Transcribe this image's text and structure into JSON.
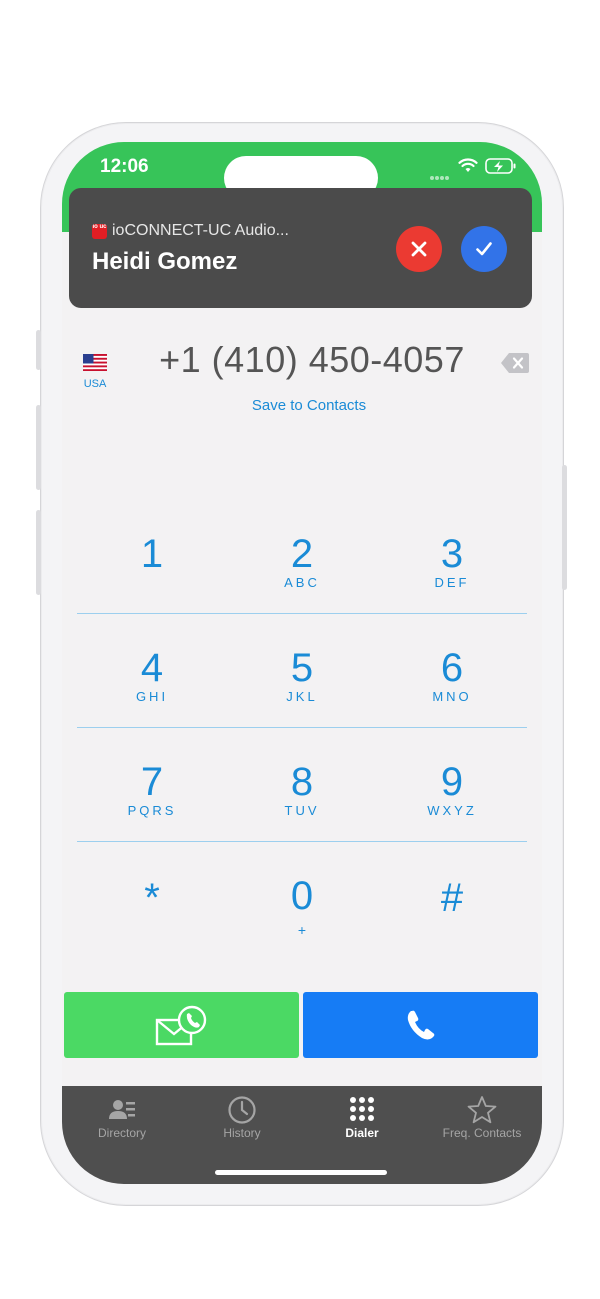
{
  "status_bar": {
    "time": "12:06"
  },
  "incoming_call": {
    "app_icon_text": "io uc",
    "app_name": "ioCONNECT-UC Audio...",
    "caller_name": "Heidi Gomez",
    "decline_icon": "close-icon",
    "accept_icon": "checkmark-icon"
  },
  "dialer": {
    "country_code": "USA",
    "phone_number": "+1 (410) 450-4057",
    "save_link": "Save to Contacts",
    "keys": [
      {
        "digit": "1",
        "letters": ""
      },
      {
        "digit": "2",
        "letters": "ABC"
      },
      {
        "digit": "3",
        "letters": "DEF"
      },
      {
        "digit": "4",
        "letters": "GHI"
      },
      {
        "digit": "5",
        "letters": "JKL"
      },
      {
        "digit": "6",
        "letters": "MNO"
      },
      {
        "digit": "7",
        "letters": "PQRS"
      },
      {
        "digit": "8",
        "letters": "TUV"
      },
      {
        "digit": "9",
        "letters": "WXYZ"
      },
      {
        "digit": "*",
        "letters": ""
      },
      {
        "digit": "0",
        "letters": "+"
      },
      {
        "digit": "#",
        "letters": ""
      }
    ]
  },
  "actions": {
    "voicemail_icon": "voicemail-icon",
    "call_icon": "phone-icon"
  },
  "tabs": [
    {
      "label": "Directory",
      "icon": "directory-icon",
      "active": false
    },
    {
      "label": "History",
      "icon": "clock-icon",
      "active": false
    },
    {
      "label": "Dialer",
      "icon": "keypad-icon",
      "active": true
    },
    {
      "label": "Freq. Contacts",
      "icon": "star-icon",
      "active": false
    }
  ],
  "colors": {
    "status_green": "#37c459",
    "accent_blue": "#1a8bd6",
    "decline_red": "#eb3a32",
    "accept_blue": "#3273e8",
    "voicemail_green": "#4bd964",
    "call_blue": "#167cf5",
    "tabbar_gray": "#4f4f4f"
  }
}
